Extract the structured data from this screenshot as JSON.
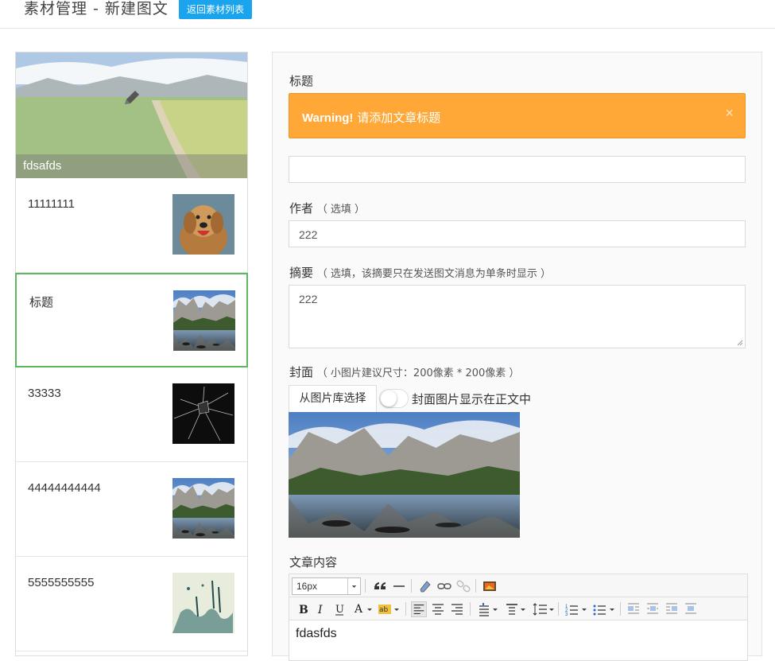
{
  "header": {
    "title": "素材管理 - 新建图文",
    "back_label": "返回素材列表"
  },
  "articles": {
    "cover_title": "fdsafds",
    "items": [
      {
        "title": "11111111",
        "thumb": "dog-photo"
      },
      {
        "title": "标题",
        "thumb": "lake-mountain-photo",
        "active": true
      },
      {
        "title": "33333",
        "thumb": "broken-glass-photo"
      },
      {
        "title": "44444444444",
        "thumb": "lake-mountain-photo"
      },
      {
        "title": "5555555555",
        "thumb": "ink-painting-photo"
      }
    ]
  },
  "form": {
    "title_label": "标题",
    "alert_strong": "Warning!",
    "alert_text": "请添加文章标题",
    "alert_close": "×",
    "title_value": "",
    "author_label": "作者",
    "author_hint": "（ 选填 ）",
    "author_value": "222",
    "summary_label": "摘要",
    "summary_hint": "（ 选填，该摘要只在发送图文消息为单条时显示 ）",
    "summary_value": "222",
    "cover_label": "封面",
    "cover_hint": "（ 小图片建议尺寸：200像素 * 200像素 ）",
    "pick_button": "从图片库选择",
    "show_cover_label": "封面图片显示在正文中",
    "show_cover_on": false,
    "content_label": "文章内容",
    "font_size": "16px",
    "content_value": "fdasfds"
  },
  "colors": {
    "accent": "#1aa4ee",
    "warning": "#ffa838",
    "active_border": "#5cb85c"
  }
}
